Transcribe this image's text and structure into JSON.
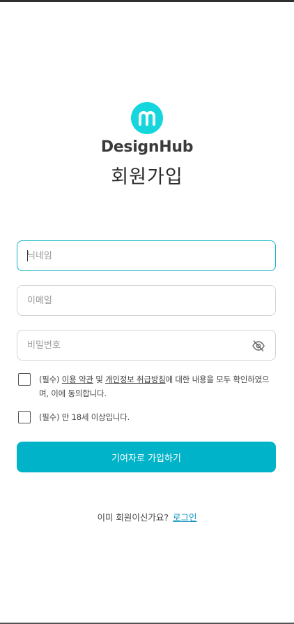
{
  "brand": {
    "name": "DesignHub",
    "logo_letter": "m",
    "accent_color": "#14d6dc"
  },
  "page": {
    "title": "회원가입"
  },
  "form": {
    "nickname": {
      "placeholder": "닉네임",
      "value": ""
    },
    "email": {
      "placeholder": "이메일",
      "value": ""
    },
    "password": {
      "placeholder": "비밀번호",
      "value": "",
      "toggle_icon": "eye-off-icon"
    }
  },
  "agreements": {
    "terms": {
      "prefix": "(필수) ",
      "link1": "이용 약관",
      "connector": " 및 ",
      "link2": "개인정보 취급방침",
      "suffix": "에 대한 내용을 모두 확인하였으며, 이에 동의합니다.",
      "checked": false
    },
    "age": {
      "text": "(필수) 만 18세 이상입니다.",
      "checked": false
    }
  },
  "submit": {
    "label": "기여자로 가입하기",
    "color": "#00b3c9"
  },
  "login_prompt": {
    "text": "이미 회원이신가요?",
    "link": "로그인",
    "link_color": "#0a8fbf"
  }
}
